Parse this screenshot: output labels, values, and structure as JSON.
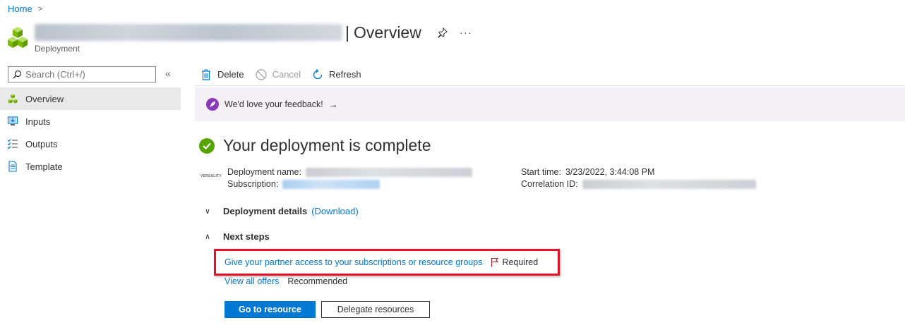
{
  "breadcrumb": {
    "home": "Home"
  },
  "header": {
    "separator": "|",
    "title": "Overview",
    "more": "···",
    "subtitle": "Deployment"
  },
  "sidebar": {
    "search_placeholder": "Search (Ctrl+/)",
    "collapse": "«",
    "items": [
      {
        "label": "Overview",
        "icon": "cubes-icon",
        "active": true
      },
      {
        "label": "Inputs",
        "icon": "monitor-input-icon"
      },
      {
        "label": "Outputs",
        "icon": "checklist-icon"
      },
      {
        "label": "Template",
        "icon": "document-icon"
      }
    ]
  },
  "toolbar": {
    "delete": "Delete",
    "cancel": "Cancel",
    "refresh": "Refresh"
  },
  "feedback": {
    "text": "We'd love your feedback!",
    "arrow": "→"
  },
  "status": {
    "text": "Your deployment is complete"
  },
  "vendor_logo": "VERSALITY",
  "info": {
    "deployment_name_label": "Deployment name:",
    "subscription_label": "Subscription:",
    "start_time_label": "Start time:",
    "start_time_value": "3/23/2022, 3:44:08 PM",
    "correlation_id_label": "Correlation ID:"
  },
  "details": {
    "title": "Deployment details",
    "download": "(Download)",
    "chevron": "∨"
  },
  "next_steps": {
    "title": "Next steps",
    "chevron": "∧",
    "partner_link": "Give your partner access to your subscriptions or resource groups",
    "required": "Required",
    "offers_link": "View all offers",
    "recommended": "Recommended"
  },
  "buttons": {
    "go_to_resource": "Go to resource",
    "delegate": "Delegate resources"
  },
  "colors": {
    "accent": "#0078d4",
    "success": "#57a300",
    "highlight": "#e81123",
    "feedback_bg": "#f5f0f8",
    "rocket": "#8a3ab9"
  }
}
